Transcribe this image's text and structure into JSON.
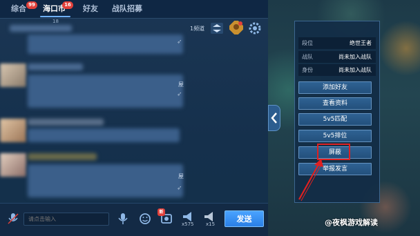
{
  "tabs": [
    {
      "label": "综合",
      "badge": "99"
    },
    {
      "label": "海口市",
      "badge": "16"
    },
    {
      "label": "好友",
      "badge": ""
    },
    {
      "label": "战队招募",
      "badge": ""
    }
  ],
  "tab_indicator": "18",
  "channel_label": "1频道",
  "profile": {
    "rows": [
      {
        "key": "段位",
        "value": "绝世王者"
      },
      {
        "key": "战队",
        "value": "尚未加入战队"
      },
      {
        "key": "身份",
        "value": "尚未加入战队"
      }
    ],
    "actions": [
      "添加好友",
      "查看资料",
      "5v5匹配",
      "5v5排位",
      "屏蔽",
      "举报发言"
    ]
  },
  "messages": [
    {
      "fragment": ""
    },
    {
      "fragment": "屋"
    },
    {
      "fragment": ""
    },
    {
      "fragment": "屋"
    }
  ],
  "input": {
    "placeholder": "请点击输入"
  },
  "send_label": "发送",
  "bottom_counts": [
    "x575",
    "x15"
  ],
  "new_badge": "新",
  "watermark": "@夜枫游戏解读",
  "colors": {
    "highlight": "#e02020",
    "send": "#2a7fe6"
  }
}
